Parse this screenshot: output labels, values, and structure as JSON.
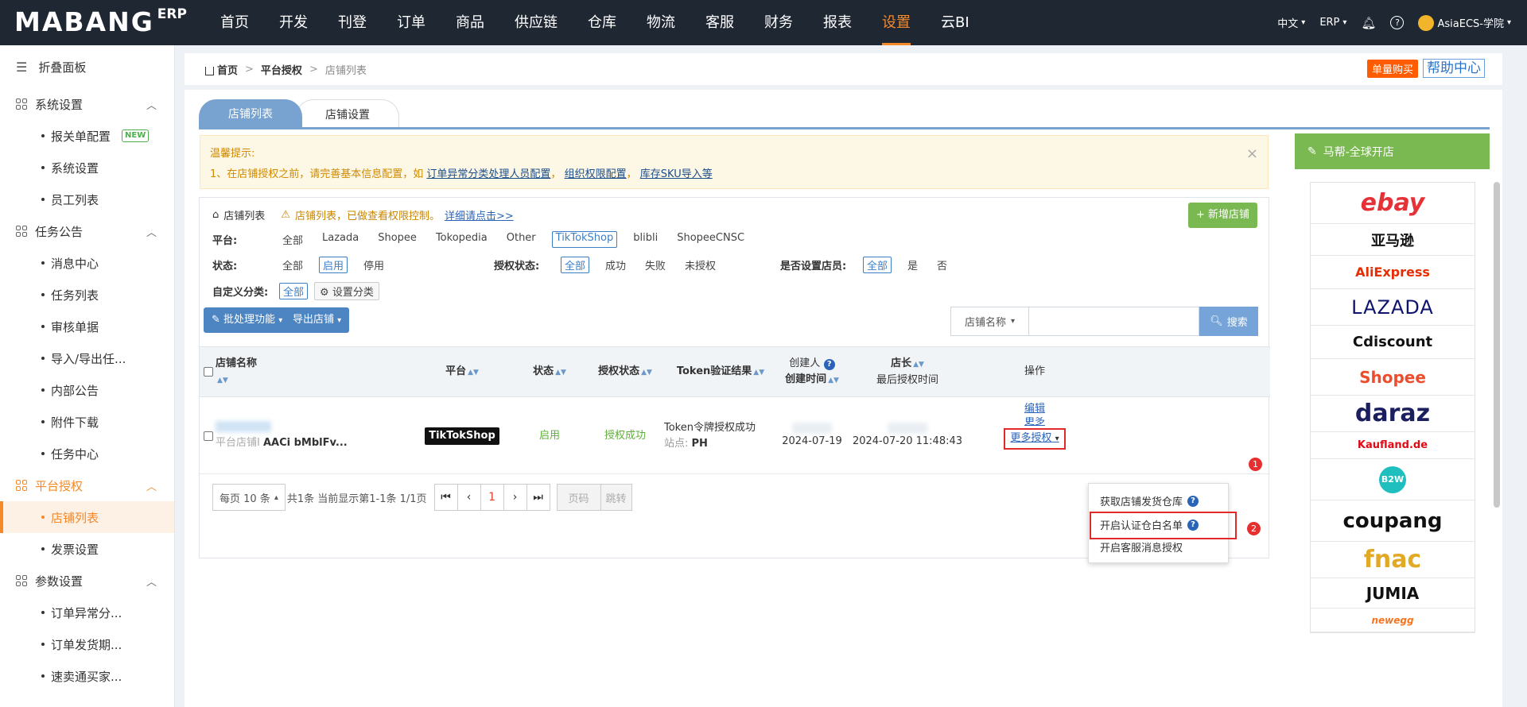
{
  "topbar": {
    "logo_main": "MABANG",
    "logo_erp": "ERP",
    "nav": [
      {
        "label": "首页",
        "active": false
      },
      {
        "label": "开发",
        "active": false
      },
      {
        "label": "刊登",
        "active": false
      },
      {
        "label": "订单",
        "active": false
      },
      {
        "label": "商品",
        "active": false
      },
      {
        "label": "供应链",
        "active": false
      },
      {
        "label": "仓库",
        "active": false
      },
      {
        "label": "物流",
        "active": false
      },
      {
        "label": "客服",
        "active": false
      },
      {
        "label": "财务",
        "active": false
      },
      {
        "label": "报表",
        "active": false
      },
      {
        "label": "设置",
        "active": true
      },
      {
        "label": "云BI",
        "active": false
      }
    ],
    "lang": "中文",
    "erp": "ERP",
    "user": "AsiaECS-学院"
  },
  "sidebar": {
    "fold_label": "折叠面板",
    "groups": [
      {
        "label": "系统设置",
        "items": [
          "报关单配置",
          "系统设置",
          "员工列表"
        ],
        "new_badge": "NEW"
      },
      {
        "label": "任务公告",
        "items": [
          "消息中心",
          "任务列表",
          "审核单据",
          "导入/导出任...",
          "内部公告",
          "附件下载",
          "任务中心"
        ]
      },
      {
        "label": "平台授权",
        "items": [
          "店铺列表",
          "发票设置"
        ]
      },
      {
        "label": "参数设置",
        "items": [
          "订单异常分...",
          "订单发货期...",
          "速卖通买家..."
        ]
      }
    ]
  },
  "breadcrumb": {
    "home": "首页",
    "mid": "平台授权",
    "last": "店铺列表"
  },
  "header_buttons": {
    "buy": "单量购买",
    "help": "帮助中心"
  },
  "tabs": [
    "店铺列表",
    "店铺设置"
  ],
  "notice": {
    "title": "温馨提示:",
    "line_prefix": "1、在店铺授权之前，请完善基本信息配置，如",
    "link1": "订单异常分类处理人员配置",
    "link2": "组织权限配置",
    "link3": "库存SKU导入等",
    "sep": "，",
    "close": "×"
  },
  "panel": {
    "title": "店铺列表",
    "warn": "店铺列表，已做查看权限控制。",
    "warn_link": "详细请点击>>",
    "add_btn": "新增店铺"
  },
  "filters": {
    "platform_label": "平台:",
    "platforms": [
      "全部",
      "Lazada",
      "Shopee",
      "Tokopedia",
      "Other",
      "TikTokShop",
      "blibli",
      "ShopeeCNSC"
    ],
    "status_label": "状态:",
    "statuses": [
      "全部",
      "启用",
      "停用"
    ],
    "auth_label": "授权状态:",
    "auth_statuses": [
      "全部",
      "成功",
      "失败",
      "未授权"
    ],
    "manager_label": "是否设置店员:",
    "manager_opts": [
      "全部",
      "是",
      "否"
    ],
    "custom_label": "自定义分类:",
    "custom_all": "全部",
    "custom_set": "设置分类"
  },
  "actions": {
    "batch": "批处理功能",
    "export": "导出店铺",
    "search_field": "店铺名称",
    "search_btn": "搜索"
  },
  "table": {
    "headers": {
      "name": "店铺名称",
      "platform": "平台",
      "status": "状态",
      "auth": "授权状态",
      "token": "Token验证结果",
      "creator": "创建人",
      "created": "创建时间",
      "manager": "店长",
      "last_auth": "最后授权时间",
      "ops": "操作"
    },
    "row": {
      "name_sub": "平台店铺I",
      "name_id": "AACi bMblFv...",
      "platform": "TikTokShop",
      "status": "启用",
      "auth": "授权成功",
      "token": "Token令牌授权成功",
      "site_label": "站点:",
      "site": "PH",
      "created": "2024-07-19",
      "last_auth": "2024-07-20 11:48:43",
      "op_edit": "编辑",
      "op_more": "更多",
      "op_more_auth": "更多授权"
    }
  },
  "pager": {
    "size": "每页 10 条",
    "info": "共1条 当前显示第1-1条 1/1页",
    "page": "1",
    "page_input": "页码",
    "go": "跳转"
  },
  "dropdown": {
    "items": [
      "获取店铺发货仓库",
      "开启认证仓白名单",
      "开启客服消息授权"
    ]
  },
  "markers": [
    "1",
    "2"
  ],
  "right_panel": {
    "title": "马帮-全球开店",
    "brands": [
      "ebay",
      "亚马逊",
      "AliExpress",
      "LAZADA",
      "Cdiscount",
      "Shopee",
      "daraz",
      "Kaufland.de",
      "B2W",
      "coupang",
      "fnac",
      "JUMIA",
      "newegg"
    ]
  },
  "colors": {
    "accent": "#f5892a",
    "topbar": "#1f2733",
    "blue": "#4c85c2",
    "green": "#7ab851",
    "red": "#e02a2a"
  }
}
